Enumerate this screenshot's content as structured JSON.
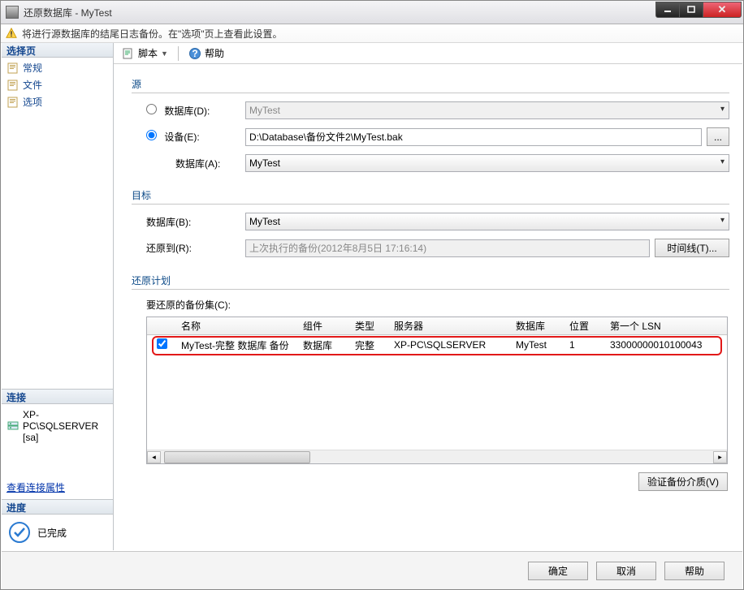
{
  "title": "还原数据库 - MyTest",
  "warning": "将进行源数据库的结尾日志备份。在\"选项\"页上查看此设置。",
  "toolbar": {
    "script_label": "脚本",
    "help_label": "帮助"
  },
  "sidebar": {
    "select_page_header": "选择页",
    "items": [
      {
        "label": "常规"
      },
      {
        "label": "文件"
      },
      {
        "label": "选项"
      }
    ],
    "connection_header": "连接",
    "connection_value": "XP-PC\\SQLSERVER [sa]",
    "view_conn_props": "查看连接属性",
    "progress_header": "进度",
    "progress_status": "已完成"
  },
  "source": {
    "group_title": "源",
    "db_label": "数据库(D):",
    "db_value": "MyTest",
    "device_label": "设备(E):",
    "device_path": "D:\\Database\\备份文件2\\MyTest.bak",
    "browse": "...",
    "device_db_label": "数据库(A):",
    "device_db_value": "MyTest",
    "radio_selected": "device"
  },
  "target": {
    "group_title": "目标",
    "db_label": "数据库(B):",
    "db_value": "MyTest",
    "restore_to_label": "还原到(R):",
    "restore_to_value": "上次执行的备份(2012年8月5日 17:16:14)",
    "timeline_btn": "时间线(T)..."
  },
  "plan": {
    "group_title": "还原计划",
    "sets_label": "要还原的备份集(C):",
    "columns": [
      "",
      "名称",
      "组件",
      "类型",
      "服务器",
      "数据库",
      "位置",
      "第一个 LSN"
    ],
    "rows": [
      {
        "checked": true,
        "name": "MyTest-完整 数据库 备份",
        "component": "数据库",
        "type": "完整",
        "server": "XP-PC\\SQLSERVER",
        "database": "MyTest",
        "position": "1",
        "first_lsn": "33000000010100043"
      }
    ],
    "verify_btn": "验证备份介质(V)"
  },
  "footer": {
    "ok": "确定",
    "cancel": "取消",
    "help": "帮助"
  }
}
